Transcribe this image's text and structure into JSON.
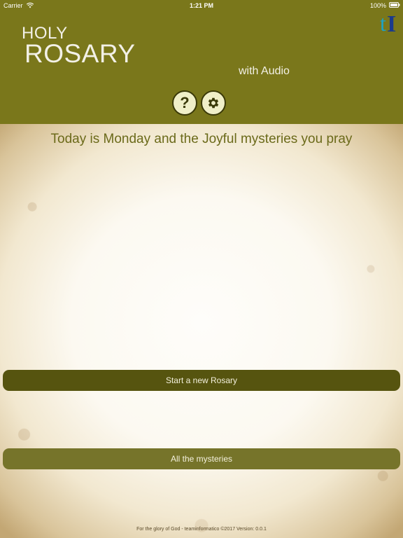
{
  "status_bar": {
    "carrier": "Carrier",
    "time": "1:21 PM",
    "battery": "100%"
  },
  "header": {
    "title_line1": "HOLY",
    "title_line2": "ROSARY",
    "subtitle": "with Audio",
    "logo_text": "tI",
    "help_label": "?",
    "background_color": "#7a771b"
  },
  "main": {
    "today_text": "Today is Monday and the Joyful mysteries you pray",
    "start_button_label": "Start a new Rosary",
    "all_mysteries_label": "All the mysteries"
  },
  "footer": {
    "text": "For the glory of God - teaminformatico ©2017 Version: 0.0.1"
  },
  "icons": {
    "wifi": "wifi-icon",
    "battery": "battery-icon",
    "help": "question-icon",
    "settings": "gear-icon",
    "logo": "app-logo"
  }
}
